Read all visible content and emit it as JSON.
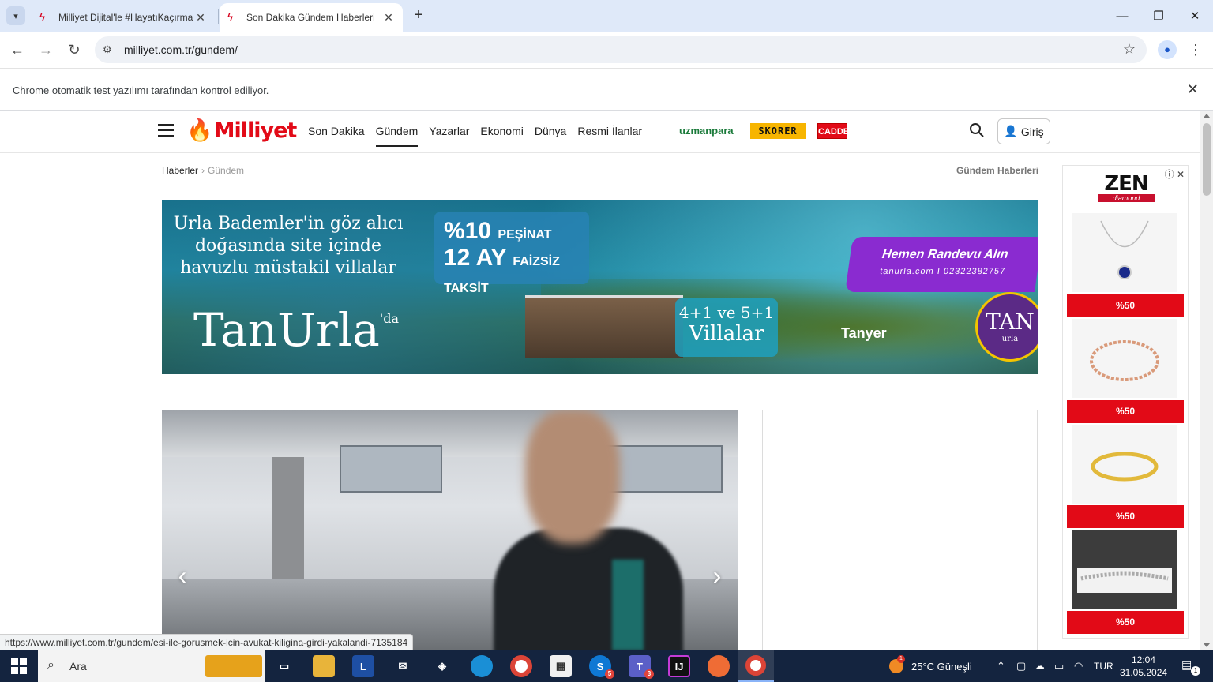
{
  "browser": {
    "tabs": [
      {
        "title": "Milliyet Dijital'le #HayatıKaçırma",
        "active": false
      },
      {
        "title": "Son Dakika Gündem Haberleri",
        "active": true
      }
    ],
    "url": "milliyet.com.tr/gundem/",
    "infobar_message": "Chrome otomatik test yazılımı tarafından kontrol ediliyor."
  },
  "site": {
    "logo": "Milliyet",
    "nav": [
      "Son Dakika",
      "Gündem",
      "Yazarlar",
      "Ekonomi",
      "Dünya",
      "Resmi İlanlar"
    ],
    "nav_current": "Gündem",
    "partners": {
      "uzmanpara": "uzmanpara",
      "skorer": "SKORER",
      "cadde": "CADDE"
    },
    "login_label": "Giriş",
    "breadcrumb": {
      "root": "Haberler",
      "current": "Gündem"
    },
    "section_title": "Gündem Haberleri"
  },
  "banner_ad": {
    "headline": "Urla Bademler'in göz alıcı doğasında site içinde havuzlu müstakil villalar",
    "brand": "TanUrla",
    "brand_sup": "'da",
    "offer_line1_big": "%10",
    "offer_line1_small": "PEŞİNAT",
    "offer_line2_big": "12 AY",
    "offer_line2_small": "FAİZSİZ TAKSİT",
    "villa_line1": "4+1 ve 5+1",
    "villa_line2": "Villalar",
    "cta": "Hemen Randevu Alın",
    "cta_contact": "tanurla.com I 02322382757",
    "developer": "Tanyer",
    "badge_top": "TAN",
    "badge_bottom": "urla"
  },
  "side_ad": {
    "brand": "ZEN",
    "brand_sub": "diamond",
    "products": [
      {
        "discount": "%50",
        "icon": "necklace-icon"
      },
      {
        "discount": "%50",
        "icon": "bracelet-icon"
      },
      {
        "discount": "%50",
        "icon": "ring-icon"
      },
      {
        "discount": "%50",
        "icon": "bracelet-icon"
      }
    ]
  },
  "status_url": "https://www.milliyet.com.tr/gundem/esi-ile-gorusmek-icin-avukat-kiligina-girdi-yakalandi-7135184",
  "taskbar": {
    "search_placeholder": "Ara",
    "apps": [
      {
        "name": "task-view",
        "label": ""
      },
      {
        "name": "file-explorer",
        "label": ""
      },
      {
        "name": "l-app",
        "label": "L"
      },
      {
        "name": "mail",
        "label": ""
      },
      {
        "name": "copilot",
        "label": ""
      },
      {
        "name": "edge",
        "label": ""
      },
      {
        "name": "chrome",
        "label": ""
      },
      {
        "name": "store",
        "label": ""
      },
      {
        "name": "skype",
        "label": "S",
        "badge": "5"
      },
      {
        "name": "teams",
        "label": "T",
        "badge": "3"
      },
      {
        "name": "intellij",
        "label": "IJ"
      },
      {
        "name": "postman",
        "label": ""
      },
      {
        "name": "chrome-active",
        "label": ""
      }
    ],
    "weather": "25°C Güneşli",
    "weather_badge": "1",
    "language": "TUR",
    "time": "12:04",
    "date": "31.05.2024",
    "notification_count": "1"
  },
  "colors": {
    "brand_red": "#e20a17",
    "tab_strip": "#dfe9f9",
    "taskbar": "#14243f"
  }
}
